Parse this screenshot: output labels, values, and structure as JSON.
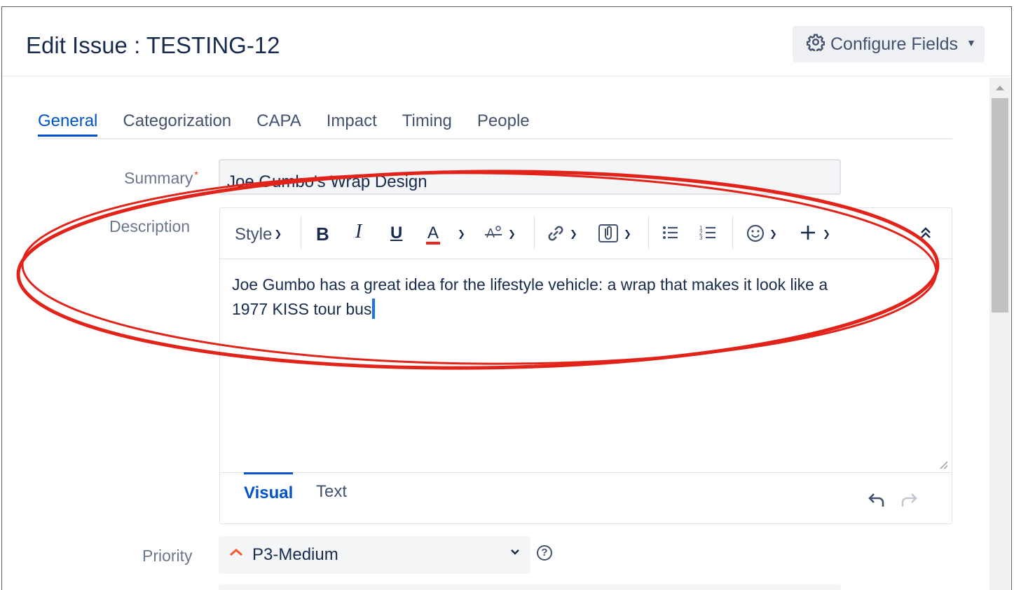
{
  "dialog": {
    "title": "Edit Issue : TESTING-12",
    "configure_fields_label": "Configure Fields"
  },
  "tabs": [
    {
      "label": "General",
      "active": true
    },
    {
      "label": "Categorization"
    },
    {
      "label": "CAPA"
    },
    {
      "label": "Impact"
    },
    {
      "label": "Timing"
    },
    {
      "label": "People"
    }
  ],
  "fields": {
    "summary_label": "Summary",
    "summary_required_mark": "*",
    "summary_value": "Joe Gumbo's Wrap Design",
    "description_label": "Description",
    "priority_label": "Priority",
    "priority_value": "P3-Medium",
    "priority_help": "?"
  },
  "editor": {
    "style_label": "Style",
    "bold": "B",
    "italic": "I",
    "underline": "U",
    "text_color": "A",
    "description_text": "Joe Gumbo has a great idea for the lifestyle vehicle: a wrap that makes it look like a 1977 KISS tour bus",
    "mode_visual": "Visual",
    "mode_text": "Text"
  },
  "colors": {
    "accent": "#0052cc",
    "annotation": "#e2231a",
    "priority_icon": "#ff5630"
  },
  "icons": [
    "gear-icon",
    "caret-down-icon",
    "chevron-down-icon",
    "text-format-clear-icon",
    "link-icon",
    "attachment-icon",
    "bullet-list-icon",
    "numbered-list-icon",
    "emoji-icon",
    "plus-icon",
    "collapse-icon",
    "undo-icon",
    "redo-icon",
    "priority-medium-icon",
    "help-icon",
    "resize-handle-icon"
  ]
}
